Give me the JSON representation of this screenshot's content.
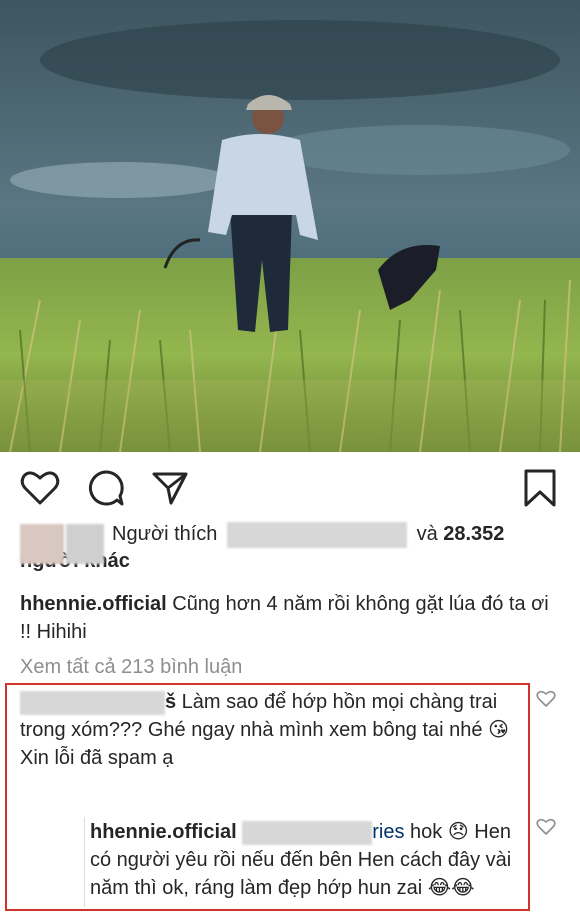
{
  "post": {
    "likes": {
      "prefix": "Người thích",
      "and": "và",
      "count": "28.352",
      "others": "người khác"
    },
    "caption": {
      "username": "hhennie.official",
      "text": " Cũng hơn 4 năm rồi không gặt lúa đó ta ơi !! Hihihi"
    },
    "view_all": "Xem tất cả 213 bình luận"
  },
  "comments": [
    {
      "name_tail": "š",
      "text": " Làm sao để hớp hồn mọi chàng trai trong xóm??? Ghé ngay nhà mình xem bông tai nhé 😘",
      "line2": "Xin lỗi đã spam ạ"
    },
    {
      "username": "hhennie.official",
      "mention_tail": "ries",
      "text": " hok 😞 Hen có người yêu rồi nếu đến bên Hen cách đây vài năm thì ok, ráng làm đẹp hớp hun zai 😂😂"
    }
  ],
  "colors": {
    "highlight_border": "#d0342c",
    "text": "#262626",
    "muted": "#8e8e8e"
  },
  "icons": [
    "heart-icon",
    "comment-icon",
    "share-icon",
    "bookmark-icon"
  ]
}
